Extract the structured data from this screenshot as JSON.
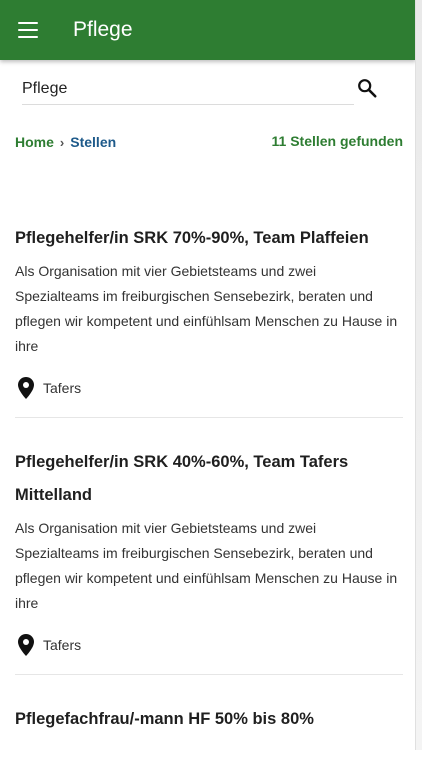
{
  "header": {
    "title": "Pflege",
    "menu_icon": "hamburger-menu-icon"
  },
  "search": {
    "value": "Pflege",
    "icon": "search-icon"
  },
  "breadcrumb": {
    "home": "Home",
    "separator": "›",
    "current": "Stellen"
  },
  "result_count": "11 Stellen gefunden",
  "jobs": [
    {
      "title": "Pflegehelfer/in SRK 70%-90%, Team Plaffeien",
      "description": "Als Organisation mit vier Gebietsteams und zwei Spezialteams im freiburgischen Sensebezirk, beraten und pflegen wir kompetent und einfühlsam Menschen zu Hause in ihre",
      "location": "Tafers"
    },
    {
      "title": "Pflegehelfer/in SRK 40%-60%, Team Tafers Mittelland",
      "description": "Als Organisation mit vier Gebietsteams und zwei Spezialteams im freiburgischen Sensebezirk, beraten und pflegen wir kompetent und einfühlsam Menschen zu Hause in ihre",
      "location": "Tafers"
    },
    {
      "title": "Pflegefachfrau/-mann HF 50% bis 80%"
    }
  ],
  "colors": {
    "primary": "#2e7d32",
    "link_blue": "#1e5a8a"
  }
}
